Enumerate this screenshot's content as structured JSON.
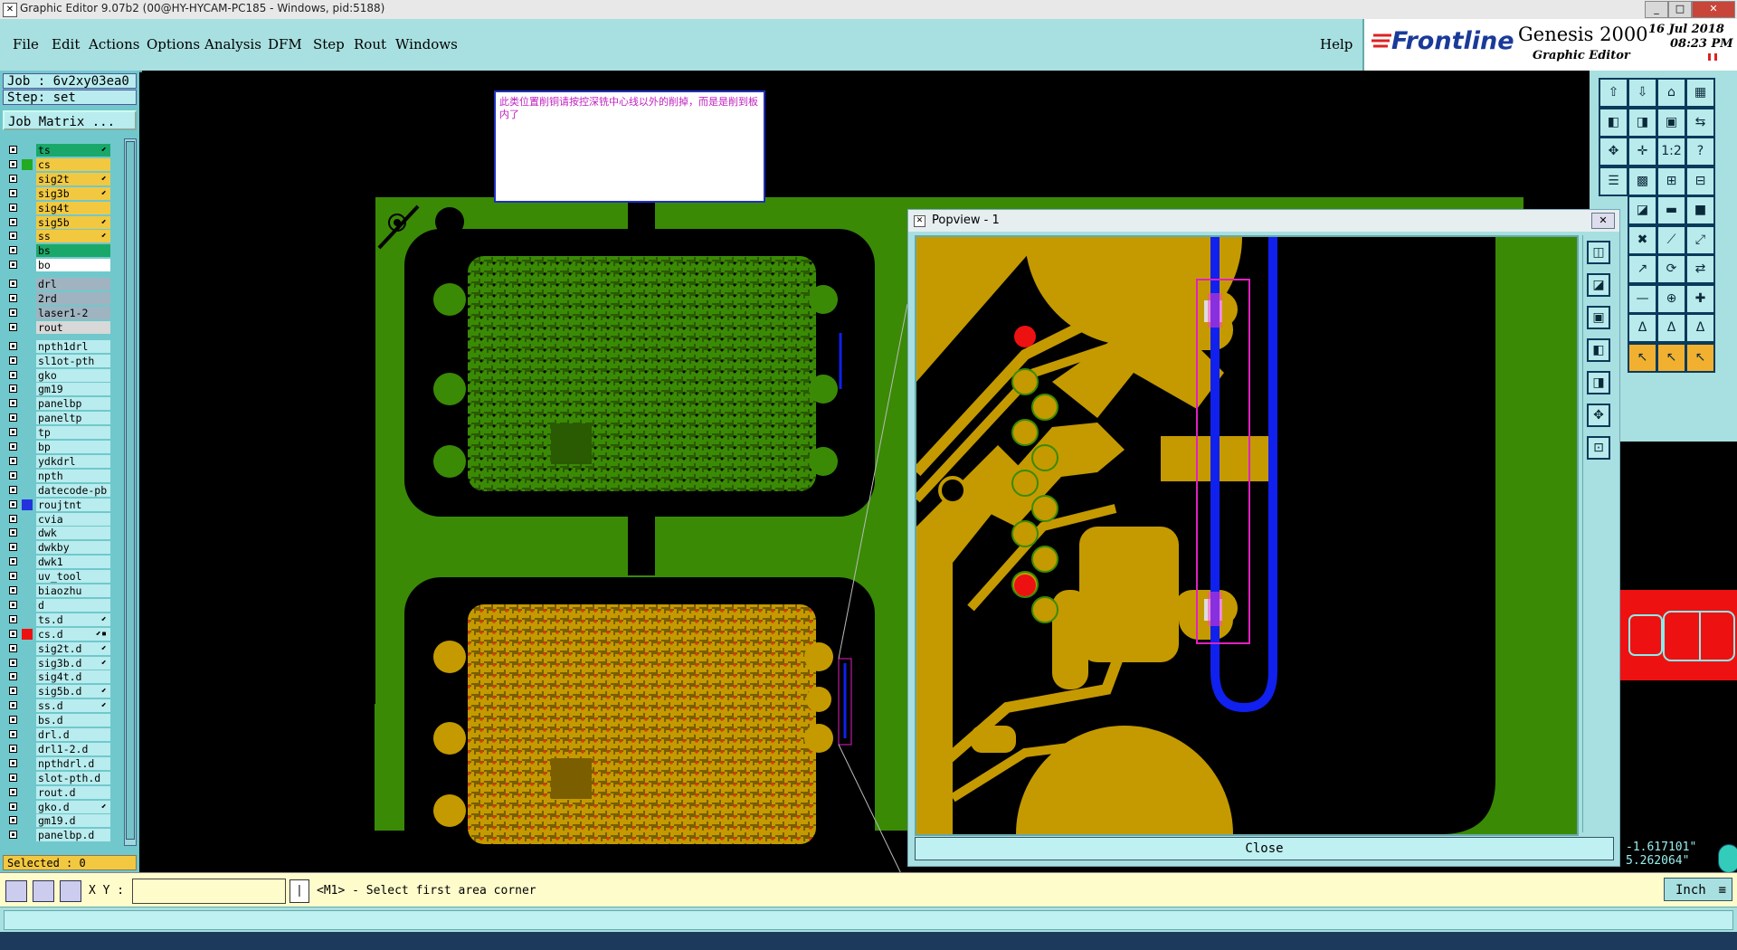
{
  "window": {
    "title": "Graphic Editor 9.07b2 (00@HY-HYCAM-PC185 - Windows, pid:5188)",
    "controls": [
      "_",
      "□",
      "✕"
    ]
  },
  "menu": {
    "items": [
      "File",
      "Edit",
      "Actions",
      "Options",
      "Analysis",
      "DFM",
      "Step",
      "Rout",
      "Windows"
    ],
    "help": "Help"
  },
  "brand": {
    "logo": "Frontline",
    "product": "Genesis 2000",
    "subtitle": "Graphic Editor",
    "date": "16 Jul 2018",
    "time": "08:23 PM"
  },
  "job": {
    "job_label": "Job : 6v2xy03ea0",
    "step_label": "Step: set",
    "matrix_button": "Job Matrix ..."
  },
  "layers": [
    {
      "name": "ts",
      "bg": "#1aa86a",
      "swatch": "",
      "flag": "⬋"
    },
    {
      "name": "cs",
      "bg": "#f2c840",
      "swatch": "#22aa22",
      "flag": ""
    },
    {
      "name": "sig2t",
      "bg": "#f2c840",
      "swatch": "",
      "flag": "⬋"
    },
    {
      "name": "sig3b",
      "bg": "#f2c840",
      "swatch": "",
      "flag": "⬋"
    },
    {
      "name": "sig4t",
      "bg": "#f2c840",
      "swatch": "",
      "flag": ""
    },
    {
      "name": "sig5b",
      "bg": "#f2c840",
      "swatch": "",
      "flag": "⬋"
    },
    {
      "name": "ss",
      "bg": "#f2c840",
      "swatch": "",
      "flag": "⬋"
    },
    {
      "name": "bs",
      "bg": "#1aa86a",
      "swatch": "",
      "flag": ""
    },
    {
      "name": "bo",
      "bg": "#ffffff",
      "swatch": "",
      "flag": ""
    },
    {
      "name": "drl",
      "bg": "#9fb4c0",
      "swatch": "",
      "flag": ""
    },
    {
      "name": "2rd",
      "bg": "#9fb4c0",
      "swatch": "",
      "flag": ""
    },
    {
      "name": "laser1-2",
      "bg": "#9fb4c0",
      "swatch": "",
      "flag": ""
    },
    {
      "name": "rout",
      "bg": "#d8d8d8",
      "swatch": "",
      "flag": ""
    },
    {
      "name": "npth1drl",
      "bg": "#b8ecee",
      "swatch": "",
      "flag": ""
    },
    {
      "name": "sl1ot-pth",
      "bg": "#b8ecee",
      "swatch": "",
      "flag": ""
    },
    {
      "name": "gko",
      "bg": "#b8ecee",
      "swatch": "",
      "flag": ""
    },
    {
      "name": "gm19",
      "bg": "#b8ecee",
      "swatch": "",
      "flag": ""
    },
    {
      "name": "panelbp",
      "bg": "#b8ecee",
      "swatch": "",
      "flag": ""
    },
    {
      "name": "paneltp",
      "bg": "#b8ecee",
      "swatch": "",
      "flag": ""
    },
    {
      "name": "tp",
      "bg": "#b8ecee",
      "swatch": "",
      "flag": ""
    },
    {
      "name": "bp",
      "bg": "#b8ecee",
      "swatch": "",
      "flag": ""
    },
    {
      "name": "ydkdrl",
      "bg": "#b8ecee",
      "swatch": "",
      "flag": ""
    },
    {
      "name": "npth",
      "bg": "#b8ecee",
      "swatch": "",
      "flag": ""
    },
    {
      "name": "datecode-pb",
      "bg": "#b8ecee",
      "swatch": "",
      "flag": ""
    },
    {
      "name": "roujtnt",
      "bg": "#b8ecee",
      "swatch": "#2233dd",
      "flag": ""
    },
    {
      "name": "cvia",
      "bg": "#b8ecee",
      "swatch": "",
      "flag": ""
    },
    {
      "name": "dwk",
      "bg": "#b8ecee",
      "swatch": "",
      "flag": ""
    },
    {
      "name": "dwkby",
      "bg": "#b8ecee",
      "swatch": "",
      "flag": ""
    },
    {
      "name": "dwk1",
      "bg": "#b8ecee",
      "swatch": "",
      "flag": ""
    },
    {
      "name": "uv_tool",
      "bg": "#b8ecee",
      "swatch": "",
      "flag": ""
    },
    {
      "name": "biaozhu",
      "bg": "#b8ecee",
      "swatch": "",
      "flag": ""
    },
    {
      "name": "d",
      "bg": "#b8ecee",
      "swatch": "",
      "flag": ""
    },
    {
      "name": "ts.d",
      "bg": "#b8ecee",
      "swatch": "",
      "flag": "⬋"
    },
    {
      "name": "cs.d",
      "bg": "#b8ecee",
      "swatch": "#ee1111",
      "flag": "⬋▪"
    },
    {
      "name": "sig2t.d",
      "bg": "#b8ecee",
      "swatch": "",
      "flag": "⬋"
    },
    {
      "name": "sig3b.d",
      "bg": "#b8ecee",
      "swatch": "",
      "flag": "⬋"
    },
    {
      "name": "sig4t.d",
      "bg": "#b8ecee",
      "swatch": "",
      "flag": ""
    },
    {
      "name": "sig5b.d",
      "bg": "#b8ecee",
      "swatch": "",
      "flag": "⬋"
    },
    {
      "name": "ss.d",
      "bg": "#b8ecee",
      "swatch": "",
      "flag": "⬋"
    },
    {
      "name": "bs.d",
      "bg": "#b8ecee",
      "swatch": "",
      "flag": ""
    },
    {
      "name": "drl.d",
      "bg": "#b8ecee",
      "swatch": "",
      "flag": ""
    },
    {
      "name": "drl1-2.d",
      "bg": "#b8ecee",
      "swatch": "",
      "flag": ""
    },
    {
      "name": "npthdrl.d",
      "bg": "#b8ecee",
      "swatch": "",
      "flag": ""
    },
    {
      "name": "slot-pth.d",
      "bg": "#b8ecee",
      "swatch": "",
      "flag": ""
    },
    {
      "name": "rout.d",
      "bg": "#b8ecee",
      "swatch": "",
      "flag": ""
    },
    {
      "name": "gko.d",
      "bg": "#b8ecee",
      "swatch": "",
      "flag": "⬋"
    },
    {
      "name": "gm19.d",
      "bg": "#b8ecee",
      "swatch": "",
      "flag": ""
    },
    {
      "name": "panelbp.d",
      "bg": "#b8ecee",
      "swatch": "",
      "flag": ""
    }
  ],
  "selected": "Selected : 0",
  "note": {
    "text": "此类位置削铜请按控深铣中心线以外的削掉，而是是削到板内了"
  },
  "popview": {
    "title": "Popview - 1",
    "close_label": "Close"
  },
  "coords": {
    "x": "-1.617101\"",
    "y": "5.262064\""
  },
  "command": {
    "xy_label": "X Y :",
    "xy_value": "",
    "prompt": "<M1> - Select first area corner",
    "units": "Inch"
  },
  "colors": {
    "copper": "#c49a00",
    "board": "#3a8a06",
    "route": "#1020ee",
    "highlight": "#e020c0",
    "hole": "#ee1111",
    "panel": "#a8dfe0"
  },
  "toolbar_icons": [
    "open-icon",
    "save-icon",
    "home-icon",
    "layout-icon",
    "prev-icon",
    "next-icon",
    "window-icon",
    "swap-icon",
    "fit-icon",
    "zoom-icon",
    "scale-icon",
    "help-icon",
    "measure-icon",
    "grid-icon",
    "feature-icon",
    "snap-icon"
  ]
}
